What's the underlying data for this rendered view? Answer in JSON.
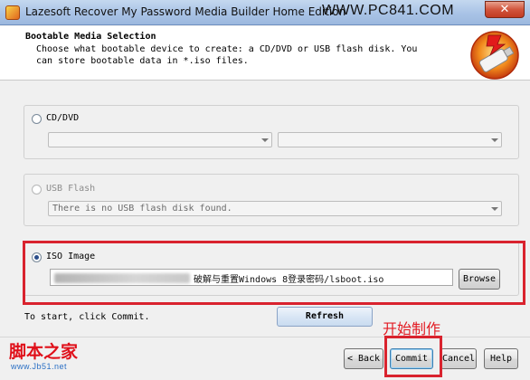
{
  "window": {
    "title": "Lazesoft Recover My Password Media Builder Home Edition",
    "watermark": "WWW.PC841.COM",
    "close_label": "✕"
  },
  "header": {
    "title": "Bootable Media Selection",
    "description": "Choose what bootable device to create: a CD/DVD or USB flash disk. You can store bootable data in *.iso files.",
    "logo_icon": "usb-flash-drive-logo"
  },
  "options": {
    "cd_dvd": {
      "label": "CD/DVD",
      "checked": false,
      "enabled": true,
      "combo1_value": "",
      "combo2_value": ""
    },
    "usb_flash": {
      "label": "USB Flash",
      "checked": false,
      "enabled": false,
      "combo_value": "There is no USB flash disk found."
    },
    "iso_image": {
      "label": "ISO Image",
      "checked": true,
      "enabled": true,
      "path_visible": "破解与重置Windows 8登录密码/lsboot.iso",
      "browse_label": "Browse"
    }
  },
  "status": {
    "hint": "To start, click Commit.",
    "refresh_label": "Refresh"
  },
  "footer": {
    "back_label": "< Back",
    "commit_label": "Commit",
    "cancel_label": "Cancel",
    "help_label": "Help"
  },
  "annotations": {
    "commit_callout": "开始制作",
    "site_name": "脚本之家",
    "site_url": "www.Jb51.net"
  },
  "colors": {
    "highlight_red": "#d9232e",
    "annotation_red": "#e21b23",
    "title_bar": "#a9c3e6"
  }
}
